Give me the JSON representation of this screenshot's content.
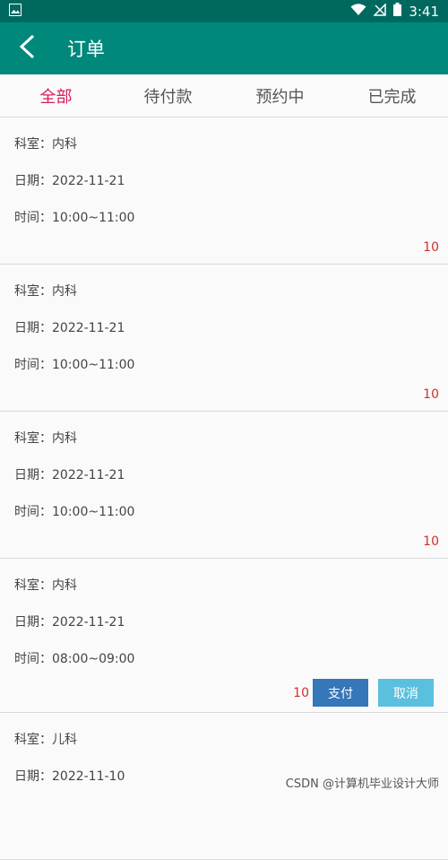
{
  "status_bar": {
    "time": "3:41"
  },
  "toolbar": {
    "title": "订单"
  },
  "tabs": [
    {
      "label": "全部"
    },
    {
      "label": "待付款"
    },
    {
      "label": "预约中"
    },
    {
      "label": "已完成"
    }
  ],
  "orders": [
    {
      "department": "科室：内科",
      "date": "日期：2022-11-21",
      "time": "时间：10:00~11:00",
      "price": "10"
    },
    {
      "department": "科室：内科",
      "date": "日期：2022-11-21",
      "time": "时间：10:00~11:00",
      "price": "10"
    },
    {
      "department": "科室：内科",
      "date": "日期：2022-11-21",
      "time": "时间：10:00~11:00",
      "price": "10"
    },
    {
      "department": "科室：内科",
      "date": "日期：2022-11-21",
      "time": "时间：08:00~09:00",
      "price": "10",
      "pay_label": "支付",
      "cancel_label": "取消"
    },
    {
      "department": "科室：儿科",
      "date": "日期：2022-11-10"
    }
  ],
  "watermark": "CSDN @计算机毕业设计大师"
}
